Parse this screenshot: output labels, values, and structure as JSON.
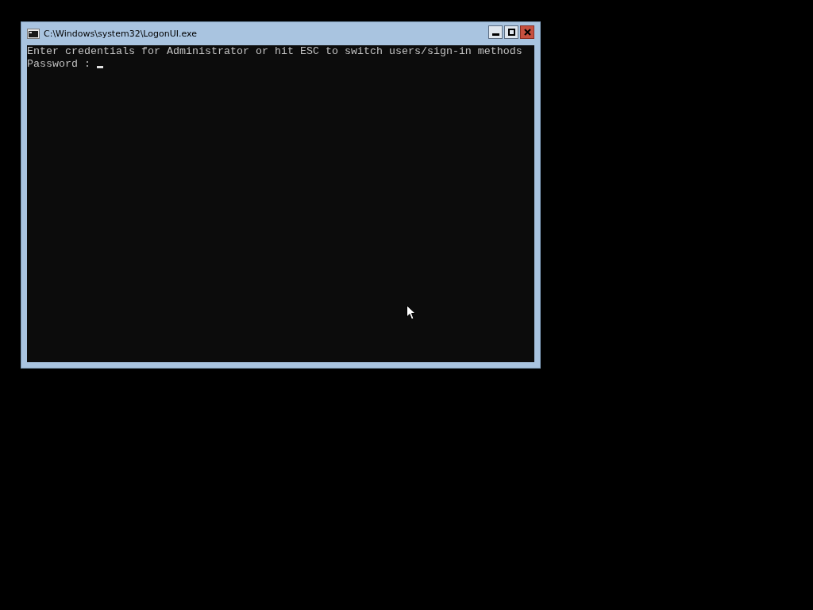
{
  "window": {
    "title": "C:\\Windows\\system32\\LogonUI.exe"
  },
  "console": {
    "lines": [
      "Enter credentials for Administrator or hit ESC to switch users/sign-in methods"
    ],
    "prompt": "Password :"
  }
}
